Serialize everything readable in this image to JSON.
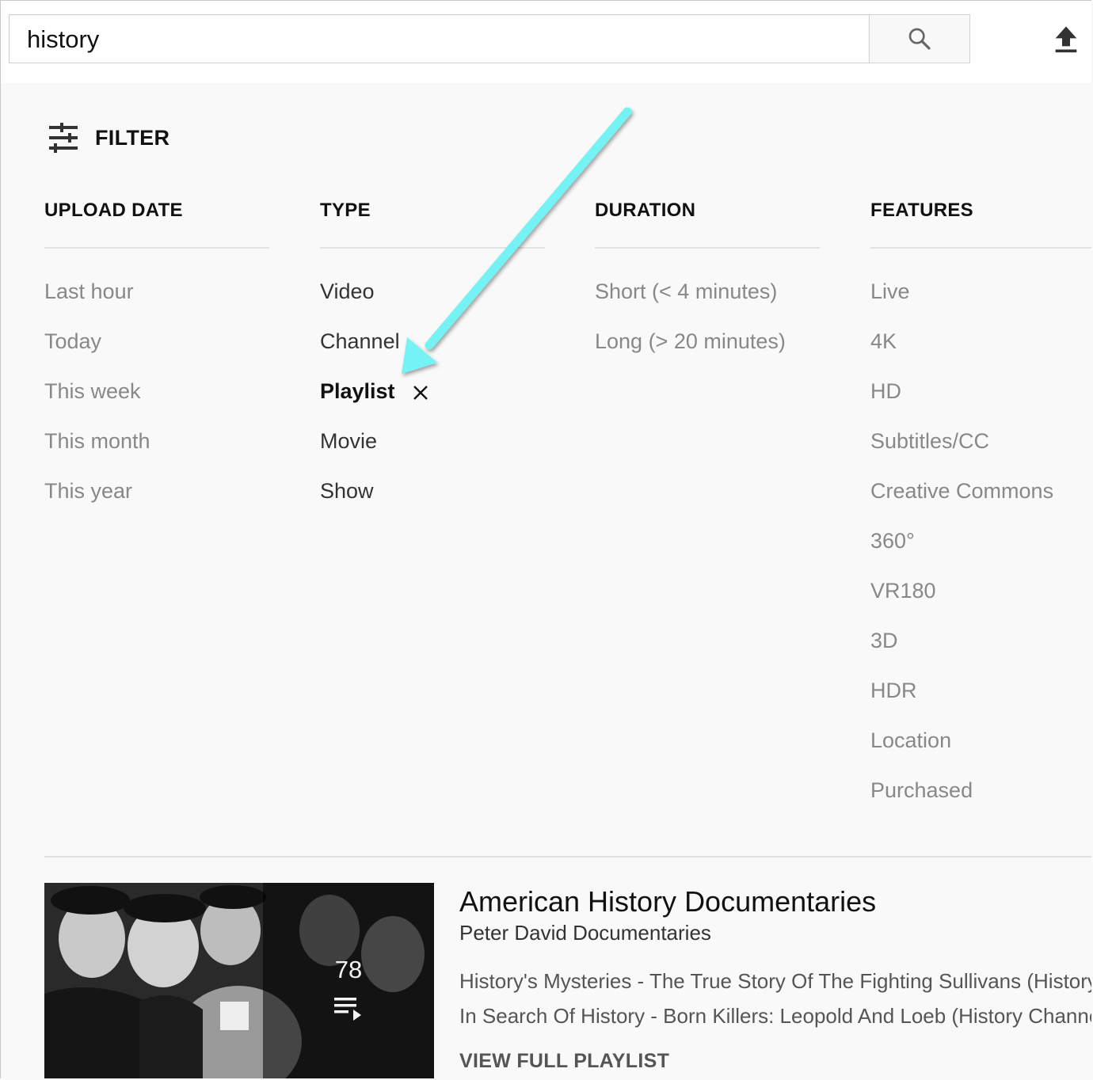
{
  "search": {
    "query": "history"
  },
  "filter": {
    "title": "FILTER",
    "columns": {
      "upload_date": {
        "title": "UPLOAD DATE",
        "options": [
          "Last hour",
          "Today",
          "This week",
          "This month",
          "This year"
        ]
      },
      "type": {
        "title": "TYPE",
        "options": [
          "Video",
          "Channel",
          "Playlist",
          "Movie",
          "Show"
        ],
        "selected": "Playlist"
      },
      "duration": {
        "title": "DURATION",
        "options": [
          "Short (< 4 minutes)",
          "Long (> 20 minutes)"
        ]
      },
      "features": {
        "title": "FEATURES",
        "options": [
          "Live",
          "4K",
          "HD",
          "Subtitles/CC",
          "Creative Commons",
          "360°",
          "VR180",
          "3D",
          "HDR",
          "Location",
          "Purchased"
        ]
      }
    }
  },
  "result": {
    "title": "American History Documentaries",
    "channel": "Peter David Documentaries",
    "video_count": "78",
    "videos": [
      "History's Mysteries - The True Story Of The Fighting Sullivans (History",
      "In Search Of History - Born Killers: Leopold And Loeb (History Channe"
    ],
    "view_full": "VIEW FULL PLAYLIST"
  },
  "colors": {
    "arrow": "#74f2f4",
    "active_text": "#111111",
    "muted_text": "#888888"
  },
  "icons": [
    "search-icon",
    "upload-icon",
    "filter-sliders-icon",
    "close-icon",
    "playlist-icon"
  ]
}
